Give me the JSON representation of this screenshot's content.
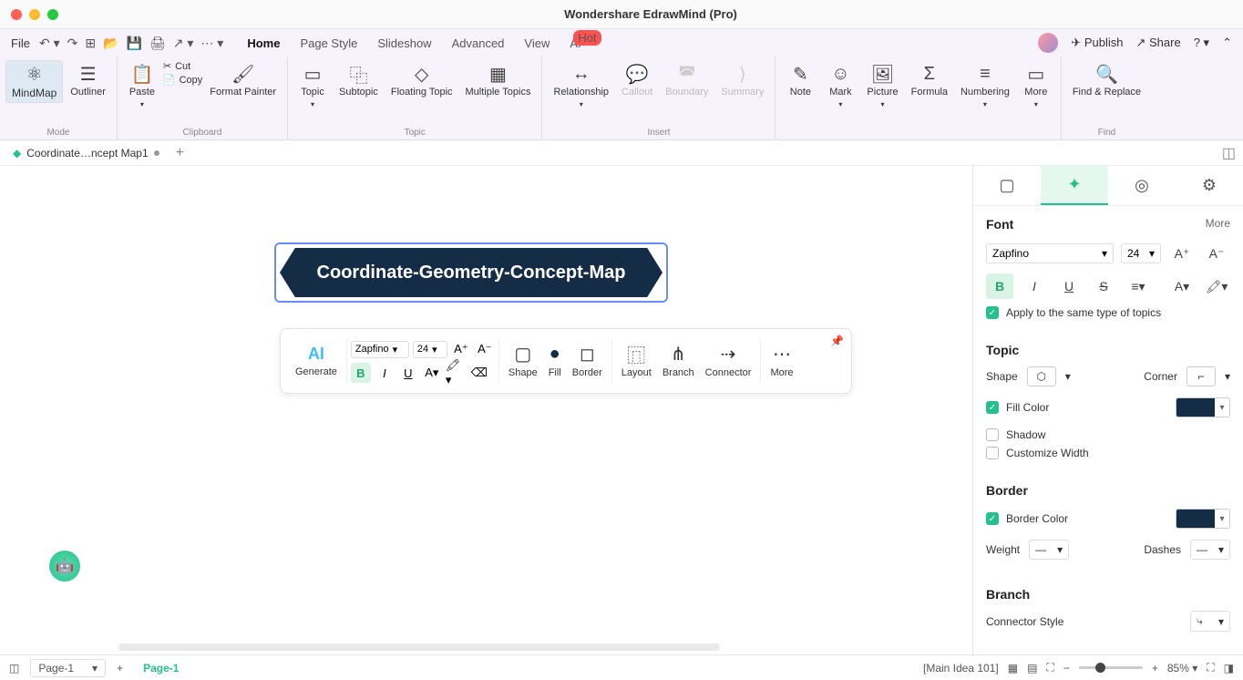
{
  "title": "Wondershare EdrawMind (Pro)",
  "menubar": {
    "file": "File",
    "tabs": [
      "Home",
      "Page Style",
      "Slideshow",
      "Advanced",
      "View",
      "AI"
    ],
    "hot": "Hot",
    "publish": "Publish",
    "share": "Share"
  },
  "ribbon": {
    "mode": {
      "mindmap": "MindMap",
      "outliner": "Outliner",
      "label": "Mode"
    },
    "clipboard": {
      "paste": "Paste",
      "cut": "Cut",
      "copy": "Copy",
      "format": "Format Painter",
      "label": "Clipboard"
    },
    "topic": {
      "topic": "Topic",
      "subtopic": "Subtopic",
      "floating": "Floating Topic",
      "multiple": "Multiple Topics",
      "label": "Topic"
    },
    "relationship": "Relationship",
    "callout": "Callout",
    "boundary": "Boundary",
    "summary": "Summary",
    "insert": {
      "note": "Note",
      "mark": "Mark",
      "picture": "Picture",
      "formula": "Formula",
      "numbering": "Numbering",
      "more": "More",
      "label": "Insert"
    },
    "find": {
      "findreplace": "Find & Replace",
      "label": "Find"
    }
  },
  "doctab": "Coordinate…ncept Map1",
  "canvas": {
    "topic_text": "Coordinate-Geometry-Concept-Map"
  },
  "floatbar": {
    "ai": "AI",
    "generate": "Generate",
    "font": "Zapfino",
    "size": "24",
    "shape": "Shape",
    "fill": "Fill",
    "border": "Border",
    "layout": "Layout",
    "branch": "Branch",
    "connector": "Connector",
    "more": "More"
  },
  "sidebar": {
    "font": {
      "title": "Font",
      "more": "More",
      "family": "Zapfino",
      "size": "24",
      "apply": "Apply to the same type of topics"
    },
    "topic": {
      "title": "Topic",
      "shape": "Shape",
      "corner": "Corner",
      "fill": "Fill Color",
      "shadow": "Shadow",
      "custom": "Customize Width",
      "fill_color": "#152c46"
    },
    "border": {
      "title": "Border",
      "color": "Border Color",
      "weight": "Weight",
      "dashes": "Dashes",
      "border_color": "#152c46"
    },
    "branch": {
      "title": "Branch",
      "connector": "Connector Style"
    }
  },
  "bottom": {
    "page": "Page-1",
    "ptab": "Page-1",
    "status": "[Main Idea 101]",
    "zoom": "85%"
  }
}
